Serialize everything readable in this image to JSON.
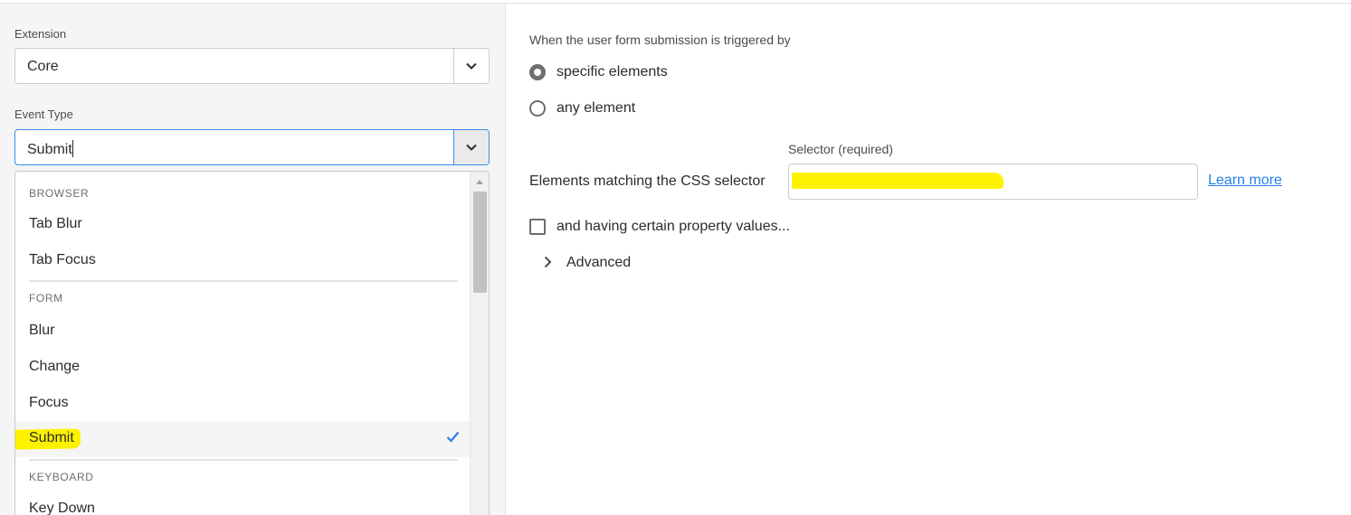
{
  "left": {
    "extension": {
      "label": "Extension",
      "value": "Core"
    },
    "event_type": {
      "label": "Event Type",
      "value": "Submit"
    },
    "menu": {
      "sections": [
        {
          "header": "BROWSER",
          "items": [
            "Tab Blur",
            "Tab Focus"
          ]
        },
        {
          "header": "FORM",
          "items": [
            "Blur",
            "Change",
            "Focus",
            "Submit"
          ]
        },
        {
          "header": "KEYBOARD",
          "items": [
            "Key Down"
          ]
        }
      ],
      "selected_item": "Submit",
      "icons": {
        "selected": "checkmark-icon",
        "scroll": "scroll-up-arrow-icon"
      },
      "accent_color": "#2680eb",
      "highlight_color": "#fff200"
    }
  },
  "right": {
    "trigger_label": "When the user form submission is triggered by",
    "options": [
      "specific elements",
      "any element"
    ],
    "selected_option": "specific elements",
    "selector": {
      "label": "Selector (required)",
      "prefix": "Elements matching the CSS selector",
      "value_redacted": true,
      "learn_more": "Learn more"
    },
    "property_checkbox": {
      "label": "and having certain property values...",
      "checked": false
    },
    "advanced": {
      "label": "Advanced",
      "icon": "chevron-right-icon"
    }
  }
}
